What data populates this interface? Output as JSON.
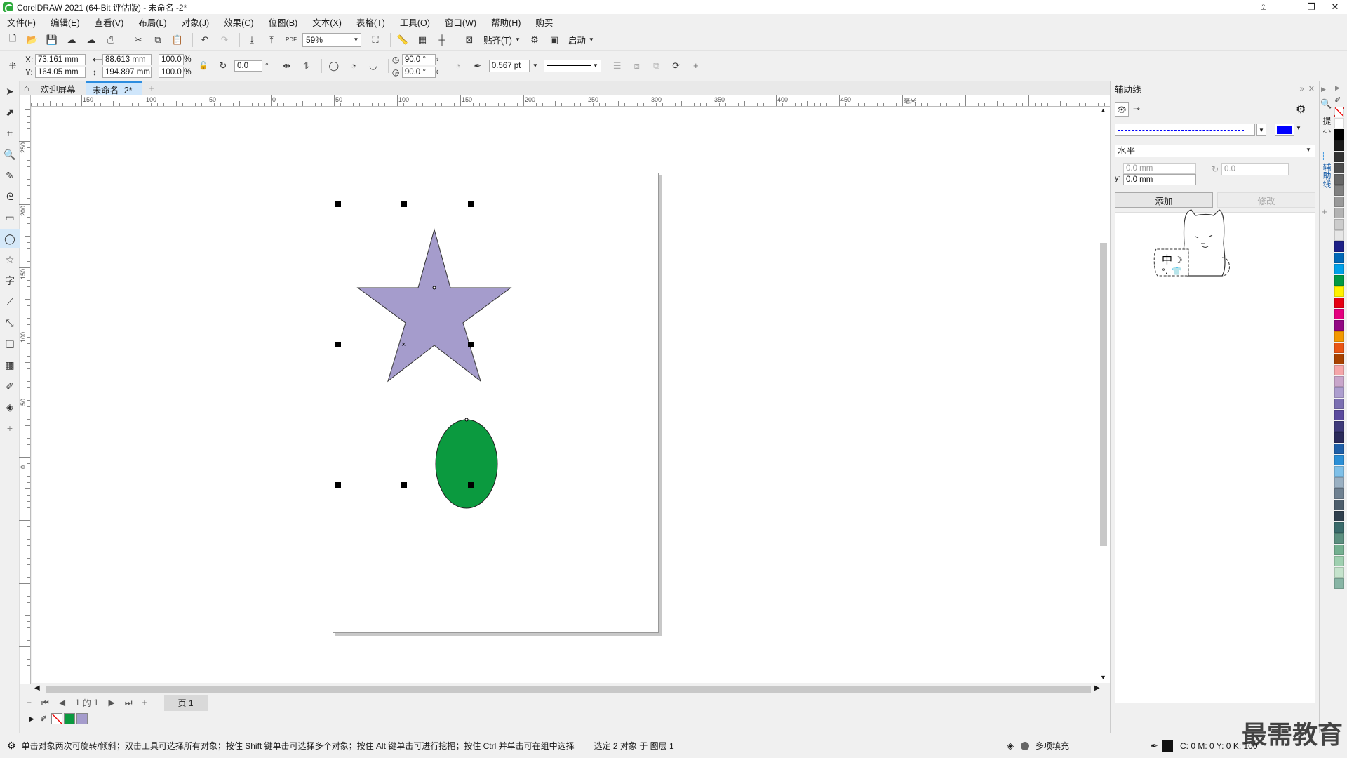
{
  "window": {
    "title": "CorelDRAW 2021 (64-Bit 评估版) - 未命名 -2*"
  },
  "menu": [
    "文件(F)",
    "编辑(E)",
    "查看(V)",
    "布局(L)",
    "对象(J)",
    "效果(C)",
    "位图(B)",
    "文本(X)",
    "表格(T)",
    "工具(O)",
    "窗口(W)",
    "帮助(H)",
    "购买"
  ],
  "toolbar": {
    "zoom": "59%",
    "snap_label": "贴齐(T)",
    "launch_label": "启动",
    "pdf_label": "PDF"
  },
  "propbar": {
    "x_label": "X:",
    "y_label": "Y:",
    "x": "73.161 mm",
    "y": "164.05 mm",
    "w": "88.613 mm",
    "h": "194.897 mm",
    "scale_w": "100.0",
    "scale_h": "100.0",
    "percent": "%",
    "rotation": "0.0",
    "degree": "°",
    "arc_start": "90.0 °",
    "arc_end": "90.0 °",
    "outline_width": "0.567 pt"
  },
  "doc_tabs": {
    "welcome": "欢迎屏幕",
    "active": "未命名 -2*"
  },
  "ruler": {
    "h_labels": [
      "150",
      "100",
      "50",
      "0",
      "50",
      "100",
      "150",
      "200",
      "250",
      "300",
      "350",
      "400",
      "450",
      "毫米"
    ],
    "v_labels": [
      "250",
      "200",
      "150",
      "100",
      "50",
      "0"
    ]
  },
  "page_nav": {
    "current": "1",
    "of": "的",
    "total": "1",
    "page_tab": "页 1"
  },
  "status": {
    "hint": "单击对象两次可旋转/倾斜；双击工具可选择所有对象；按住 Shift 键单击可选择多个对象；按住 Alt 键单击可进行挖掘；按住 Ctrl 并单击可在组中选择",
    "selection": "选定 2 对象 于 图层 1",
    "fill": "多项填充",
    "color_readout": "C: 0 M: 0 Y: 0 K: 100"
  },
  "docker": {
    "title": "辅助线",
    "orientation": "水平",
    "x_value": "0.0 mm",
    "y_label": "y:",
    "y_value": "0.0 mm",
    "angle": "0.0",
    "add_button": "添加",
    "modify_button": "修改",
    "line_color": "#0000ff",
    "mascot_text": "中"
  },
  "side_tabs": {
    "hints": "提示",
    "guides": "辅助线"
  },
  "shapes": {
    "star_fill": "#a59ccc",
    "ellipse_fill": "#0b9a3f"
  },
  "palette_colors": [
    "#ffffff",
    "#000000",
    "#1a1a1a",
    "#333333",
    "#4d4d4d",
    "#666666",
    "#808080",
    "#999999",
    "#b3b3b3",
    "#cccccc",
    "#e6e6e6",
    "#1d2087",
    "#0068b7",
    "#00a0e9",
    "#009944",
    "#fff100",
    "#e60012",
    "#e4007f",
    "#920783",
    "#f39800",
    "#ea5514",
    "#a84200",
    "#f5a6a9",
    "#c9a6cb",
    "#ad9ecf",
    "#7b6fb2",
    "#5b4a9e",
    "#3e3a7a",
    "#2a2a5a",
    "#1e5fa8",
    "#2b8fd6",
    "#7fc0e8",
    "#9ab0c2",
    "#6f8191",
    "#4d5d6b",
    "#2f3f4d",
    "#3a6b6b",
    "#5b8f7f",
    "#74b090",
    "#9fd0b0",
    "#c5e3cc",
    "#88b5a5"
  ],
  "watermark": "最需教育"
}
